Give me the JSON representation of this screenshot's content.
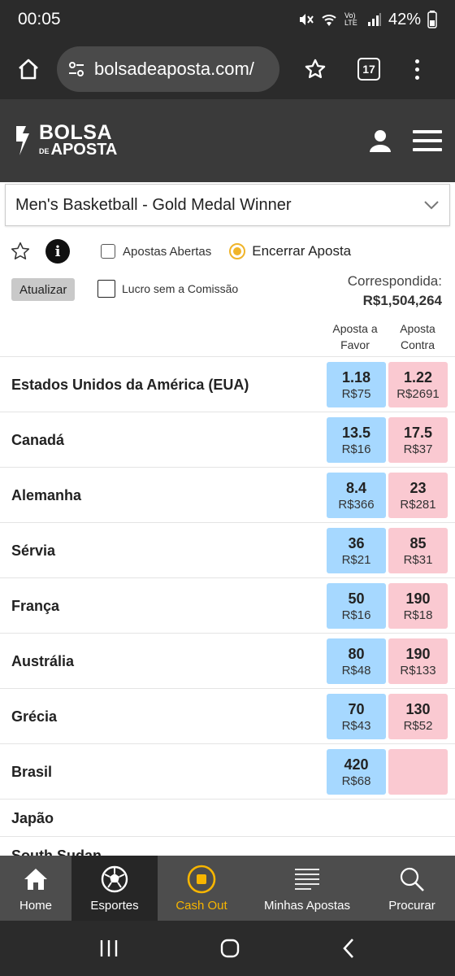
{
  "status_bar": {
    "time": "00:05",
    "battery": "42%",
    "network_label": "Vo) LTE"
  },
  "browser": {
    "url": "bolsadeaposta.com/",
    "tab_count": "17"
  },
  "site_header": {
    "logo_line1": "BOLSA",
    "logo_line2_small": "DE",
    "logo_line2": "APOSTA"
  },
  "market": {
    "title": "Men's Basketball - Gold Medal Winner"
  },
  "options": {
    "info": "i",
    "open_bets_label": "Apostas Abertas",
    "cashout_label": "Encerrar Aposta",
    "refresh_label": "Atualizar",
    "no_commission_label": "Lucro sem a Comissão",
    "matched_label": "Correspondida:",
    "matched_value": "R$1,504,264"
  },
  "columns": {
    "back_line1": "Aposta a",
    "back_line2": "Favor",
    "lay_line1": "Aposta",
    "lay_line2": "Contra"
  },
  "runners": [
    {
      "name": "Estados Unidos da América (EUA)",
      "back_price": "1.18",
      "back_size": "R$75",
      "lay_price": "1.22",
      "lay_size": "R$2691"
    },
    {
      "name": "Canadá",
      "back_price": "13.5",
      "back_size": "R$16",
      "lay_price": "17.5",
      "lay_size": "R$37"
    },
    {
      "name": "Alemanha",
      "back_price": "8.4",
      "back_size": "R$366",
      "lay_price": "23",
      "lay_size": "R$281"
    },
    {
      "name": "Sérvia",
      "back_price": "36",
      "back_size": "R$21",
      "lay_price": "85",
      "lay_size": "R$31"
    },
    {
      "name": "França",
      "back_price": "50",
      "back_size": "R$16",
      "lay_price": "190",
      "lay_size": "R$18"
    },
    {
      "name": "Austrália",
      "back_price": "80",
      "back_size": "R$48",
      "lay_price": "190",
      "lay_size": "R$133"
    },
    {
      "name": "Grécia",
      "back_price": "70",
      "back_size": "R$43",
      "lay_price": "130",
      "lay_size": "R$52"
    },
    {
      "name": "Brasil",
      "back_price": "420",
      "back_size": "R$68",
      "lay_price": "",
      "lay_size": ""
    },
    {
      "name": "Japão"
    },
    {
      "name": "South Sudan"
    }
  ],
  "bottom_nav": {
    "home": "Home",
    "sports": "Esportes",
    "cashout": "Cash Out",
    "my_bets": "Minhas Apostas",
    "search": "Procurar"
  },
  "colors": {
    "back": "#a6d8ff",
    "lay": "#fac9d1",
    "accent": "#f7b500"
  }
}
